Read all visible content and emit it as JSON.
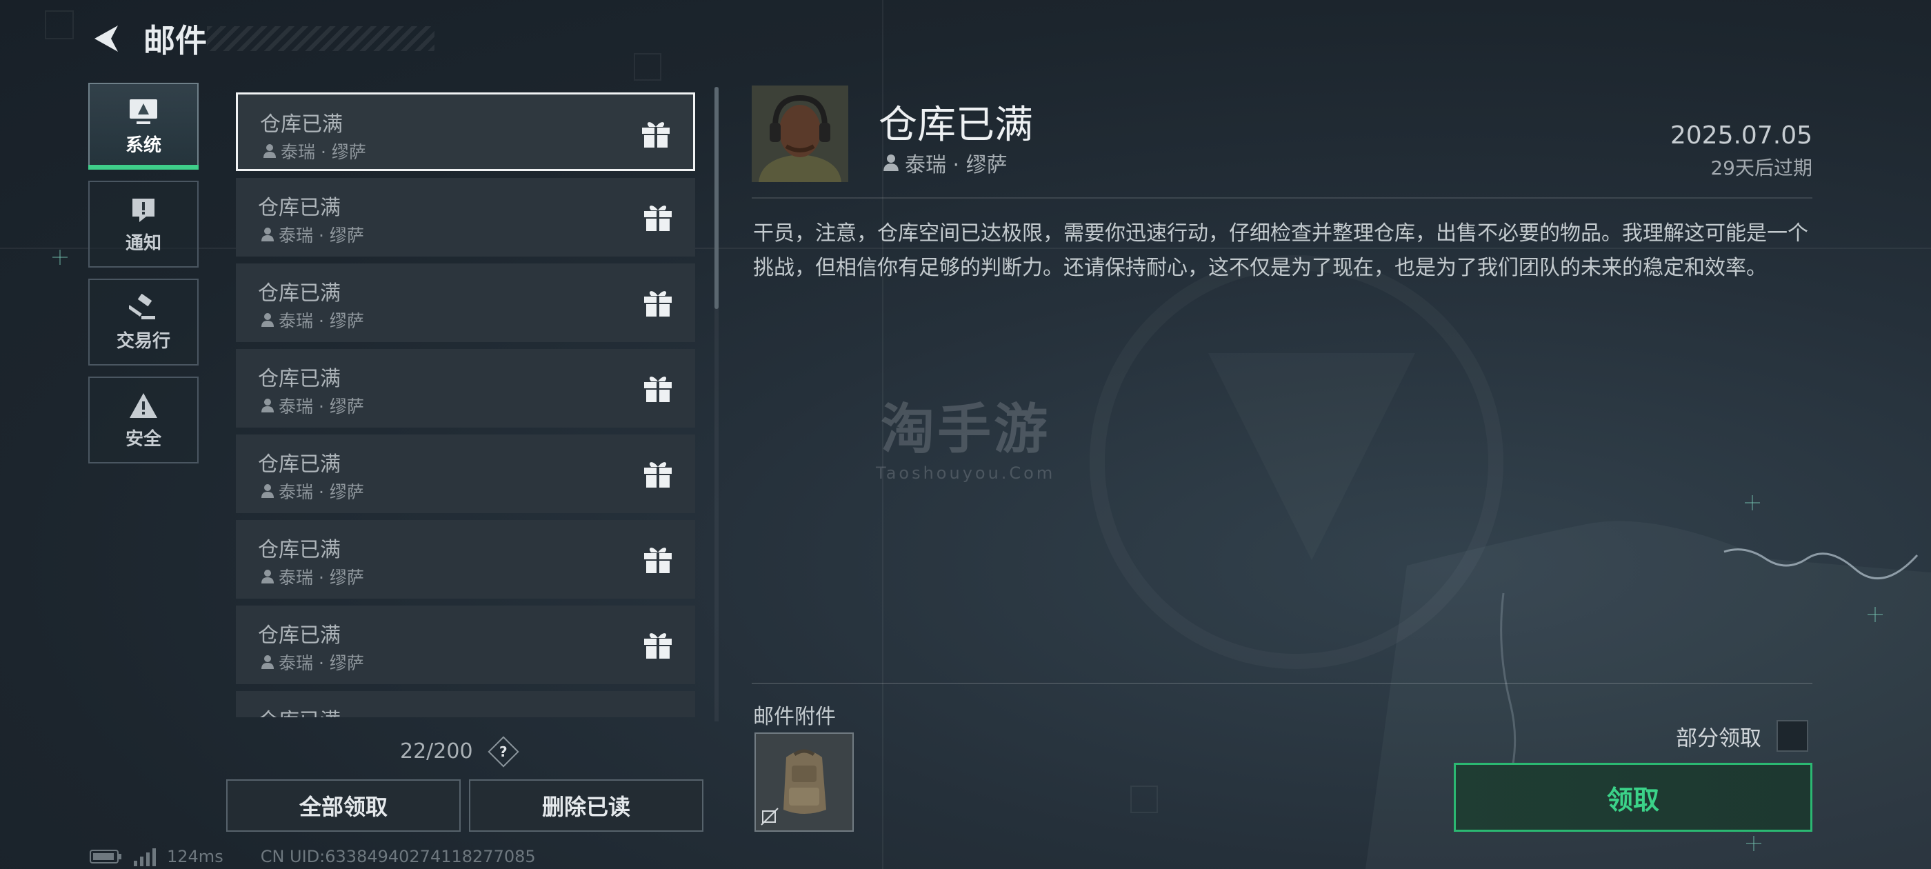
{
  "header": {
    "title": "邮件"
  },
  "categories": [
    {
      "label": "系统",
      "icon": "monitor-icon",
      "active": true
    },
    {
      "label": "通知",
      "icon": "notice-icon",
      "active": false
    },
    {
      "label": "交易行",
      "icon": "gavel-icon",
      "active": false
    },
    {
      "label": "安全",
      "icon": "warning-icon",
      "active": false
    }
  ],
  "mails": [
    {
      "title": "仓库已满",
      "sender": "泰瑞 · 缪萨"
    },
    {
      "title": "仓库已满",
      "sender": "泰瑞 · 缪萨"
    },
    {
      "title": "仓库已满",
      "sender": "泰瑞 · 缪萨"
    },
    {
      "title": "仓库已满",
      "sender": "泰瑞 · 缪萨"
    },
    {
      "title": "仓库已满",
      "sender": "泰瑞 · 缪萨"
    },
    {
      "title": "仓库已满",
      "sender": "泰瑞 · 缪萨"
    },
    {
      "title": "仓库已满",
      "sender": "泰瑞 · 缪萨"
    },
    {
      "title": "仓库已满",
      "sender": ""
    }
  ],
  "list": {
    "counter": "22/200",
    "help_label": "?",
    "claim_all_label": "全部领取",
    "delete_read_label": "删除已读"
  },
  "status": {
    "ping": "124ms",
    "uid": "CN UID:63384940274118277085"
  },
  "detail": {
    "title": "仓库已满",
    "sender": "泰瑞 · 缪萨",
    "date": "2025.07.05",
    "expire": "29天后过期",
    "body": "干员，注意，仓库空间已达极限，需要你迅速行动，仔细检查并整理仓库，出售不必要的物品。我理解这可能是一个挑战，但相信你有足够的判断力。还请保持耐心，这不仅是为了现在，也是为了我们团队的未来的稳定和效率。",
    "attachments_label": "邮件附件",
    "partial_claim_label": "部分领取",
    "claim_label": "领取"
  },
  "watermark": {
    "main": "淘手游",
    "sub": "Taoshouyou.Com"
  },
  "colors": {
    "accent_green": "#3bd389",
    "selected_border": "#f1f3f4"
  }
}
